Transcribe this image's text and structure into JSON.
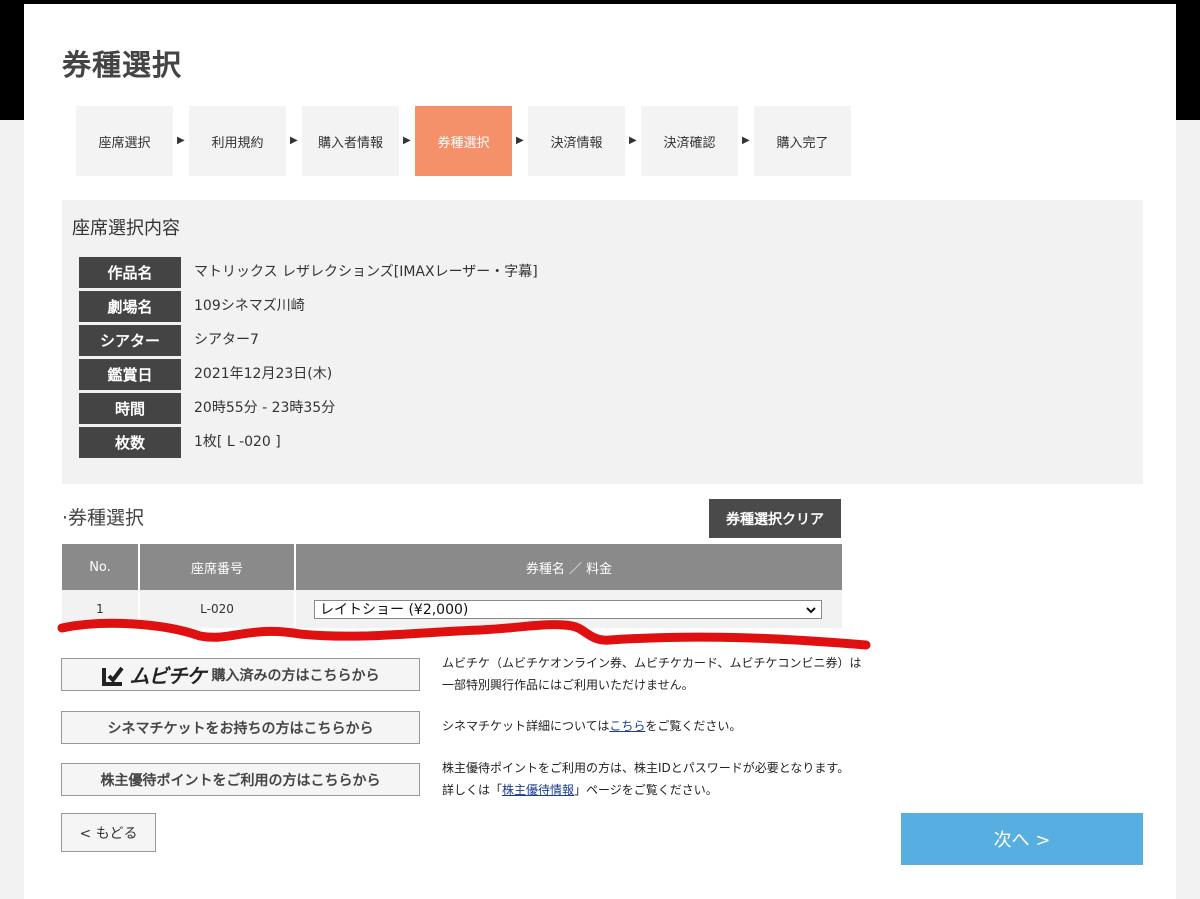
{
  "page_title": "券種選択",
  "steps": [
    {
      "label": "座席選択",
      "active": false
    },
    {
      "label": "利用規約",
      "active": false
    },
    {
      "label": "購入者情報",
      "active": false
    },
    {
      "label": "券種選択",
      "active": true
    },
    {
      "label": "決済情報",
      "active": false
    },
    {
      "label": "決済確認",
      "active": false
    },
    {
      "label": "購入完了",
      "active": false
    }
  ],
  "step_arrow": "▶",
  "summary": {
    "title": "座席選択内容",
    "rows": [
      {
        "label": "作品名",
        "value": "マトリックス レザレクションズ[IMAXレーザー・字幕]"
      },
      {
        "label": "劇場名",
        "value": "109シネマズ川崎"
      },
      {
        "label": "シアター",
        "value": "シアター7"
      },
      {
        "label": "鑑賞日",
        "value": "2021年12月23日(木)"
      },
      {
        "label": "時間",
        "value": "20時55分 - 23時35分"
      },
      {
        "label": "枚数",
        "value": "1枚[ L -020 ]"
      }
    ]
  },
  "ticket_section": {
    "title": "·券種選択",
    "clear_button": "券種選択クリア",
    "headers": {
      "no": "No.",
      "seat": "座席番号",
      "type": "券種名 ／ 料金"
    },
    "rows": [
      {
        "no": "1",
        "seat": "L-020",
        "selected": "レイトショー (¥2,000)"
      }
    ]
  },
  "options": {
    "mubichike_logo": "ムビチケ",
    "mubichike_button": "購入済みの方はこちらから",
    "mubichike_note_1": "ムビチケ（ムビチケオンライン券、ムビチケカード、ムビチケコンビニ券）は",
    "mubichike_note_2": "一部特別興行作品にはご利用いただけません。",
    "cinema_button": "シネマチケットをお持ちの方はこちらから",
    "cinema_note_pre": "シネマチケット詳細については",
    "cinema_note_link": "こちら",
    "cinema_note_post": "をご覧ください。",
    "shareholder_button": "株主優待ポイントをご利用の方はこちらから",
    "shareholder_note_1": "株主優待ポイントをご利用の方は、株主IDとパスワードが必要となります。",
    "shareholder_note_2_pre": "詳しくは「",
    "shareholder_note_2_link": "株主優待情報",
    "shareholder_note_2_post": "」ページをご覧ください。"
  },
  "nav": {
    "back": "< もどる",
    "next": "次へ >"
  },
  "colors": {
    "active_step": "#f4906a",
    "next_button": "#57aee0",
    "label_bg": "#444444",
    "scribble": "#e01010"
  }
}
